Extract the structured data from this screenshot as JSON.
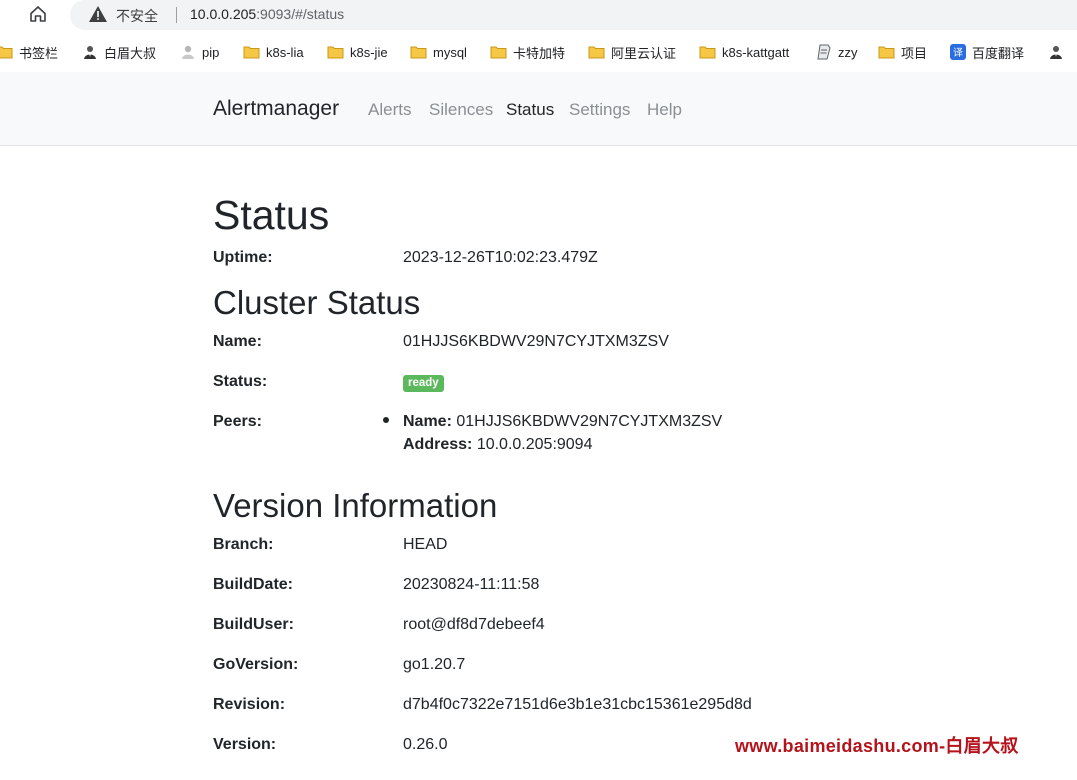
{
  "browser": {
    "insecure_label": "不安全",
    "url_host": "10.0.0.205",
    "url_rest": ":9093/#/status",
    "bookmarks": [
      {
        "label": "书签栏",
        "icon": "folder-icon"
      },
      {
        "label": "白眉大叔",
        "icon": "person-icon"
      },
      {
        "label": "pip",
        "icon": "user-icon"
      },
      {
        "label": "k8s-lia",
        "icon": "folder-icon"
      },
      {
        "label": "k8s-jie",
        "icon": "folder-icon"
      },
      {
        "label": "mysql",
        "icon": "folder-icon"
      },
      {
        "label": "卡特加特",
        "icon": "folder-icon"
      },
      {
        "label": "阿里云认证",
        "icon": "folder-icon"
      },
      {
        "label": "k8s-kattgatt",
        "icon": "folder-icon"
      },
      {
        "label": "zzy",
        "icon": "page-icon"
      },
      {
        "label": "项目",
        "icon": "folder-icon"
      },
      {
        "label": "百度翻译",
        "icon": "translate-icon"
      }
    ]
  },
  "nav": {
    "brand": "Alertmanager",
    "links": [
      "Alerts",
      "Silences",
      "Status",
      "Settings",
      "Help"
    ],
    "active": "Status"
  },
  "status": {
    "title": "Status",
    "uptime_label": "Uptime:",
    "uptime_value": "2023-12-26T10:02:23.479Z"
  },
  "cluster": {
    "title": "Cluster Status",
    "name_label": "Name:",
    "name_value": "01HJJS6KBDWV29N7CYJTXM3ZSV",
    "status_label": "Status:",
    "status_badge": "ready",
    "peers_label": "Peers:",
    "peer_name_label": "Name:",
    "peer_name_value": "01HJJS6KBDWV29N7CYJTXM3ZSV",
    "peer_address_label": "Address:",
    "peer_address_value": "10.0.0.205:9094"
  },
  "version": {
    "title": "Version Information",
    "rows": [
      {
        "label": "Branch:",
        "value": "HEAD"
      },
      {
        "label": "BuildDate:",
        "value": "20230824-11:11:58"
      },
      {
        "label": "BuildUser:",
        "value": "root@df8d7debeef4"
      },
      {
        "label": "GoVersion:",
        "value": "go1.20.7"
      },
      {
        "label": "Revision:",
        "value": "d7b4f0c7322e7151d6e3b1e31cbc15361e295d8d"
      },
      {
        "label": "Version:",
        "value": "0.26.0"
      }
    ]
  },
  "watermark": "www.baimeidashu.com-白眉大叔",
  "colors": {
    "badge_success": "#5cb85c",
    "navbar_bg": "#f8f9fa",
    "nav_inactive": "#8a8f94",
    "watermark": "#b5121b"
  }
}
